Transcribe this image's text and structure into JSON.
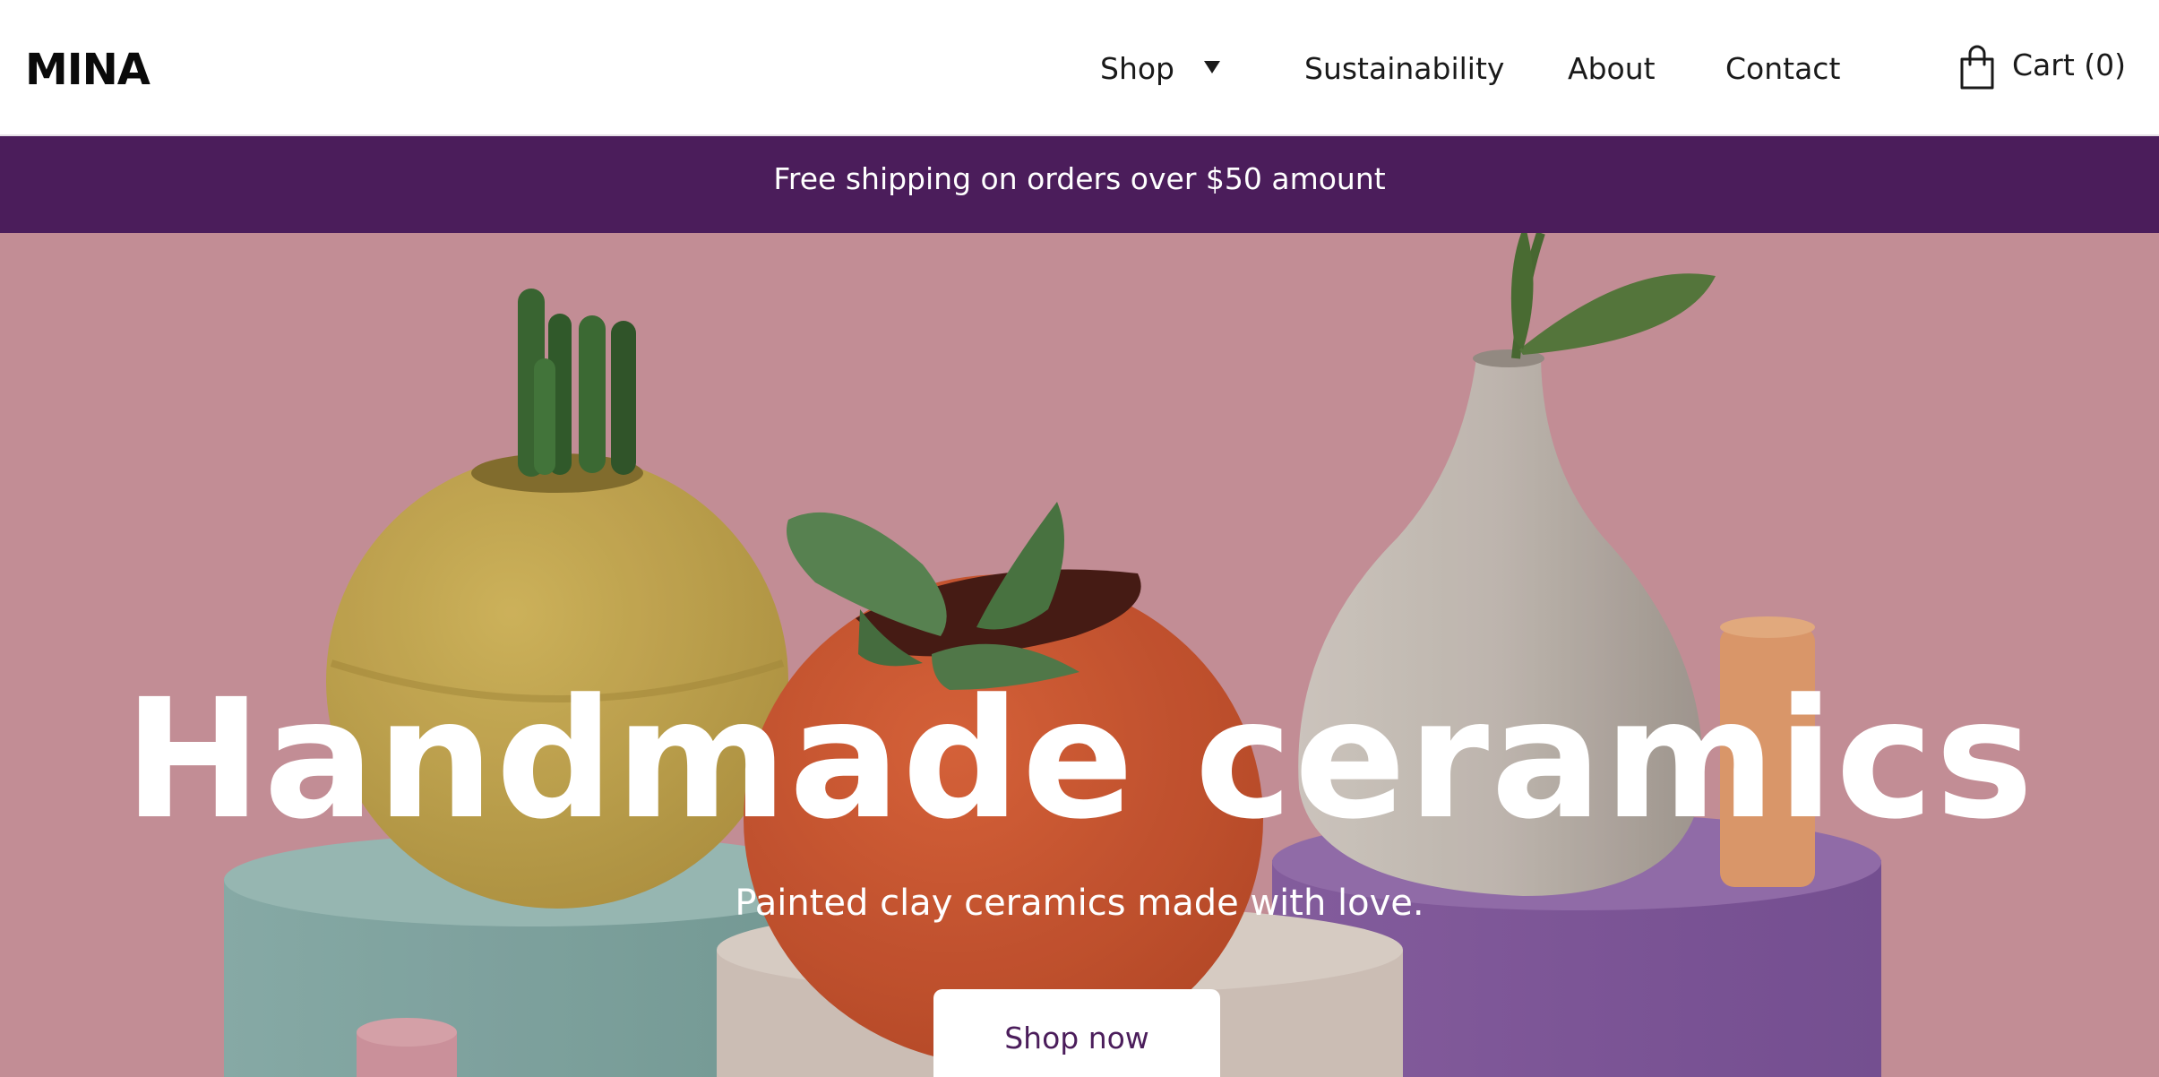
{
  "header": {
    "logo": "MINA",
    "nav": {
      "shop": "Shop",
      "sustainability": "Sustainability",
      "about": "About",
      "contact": "Contact"
    },
    "cart_label": "Cart (0)"
  },
  "banner": {
    "text": "Free shipping on orders over $50 amount"
  },
  "hero": {
    "title": "Handmade ceramics",
    "subtitle": "Painted clay ceramics made with love.",
    "cta_label": "Shop now"
  },
  "colors": {
    "banner_bg": "#4b1d5b",
    "cta_text": "#4b1d5b",
    "hero_bg": "#cf969f"
  },
  "icons": {
    "shop_dropdown": "caret-down-icon",
    "cart": "shopping-bag-icon"
  }
}
